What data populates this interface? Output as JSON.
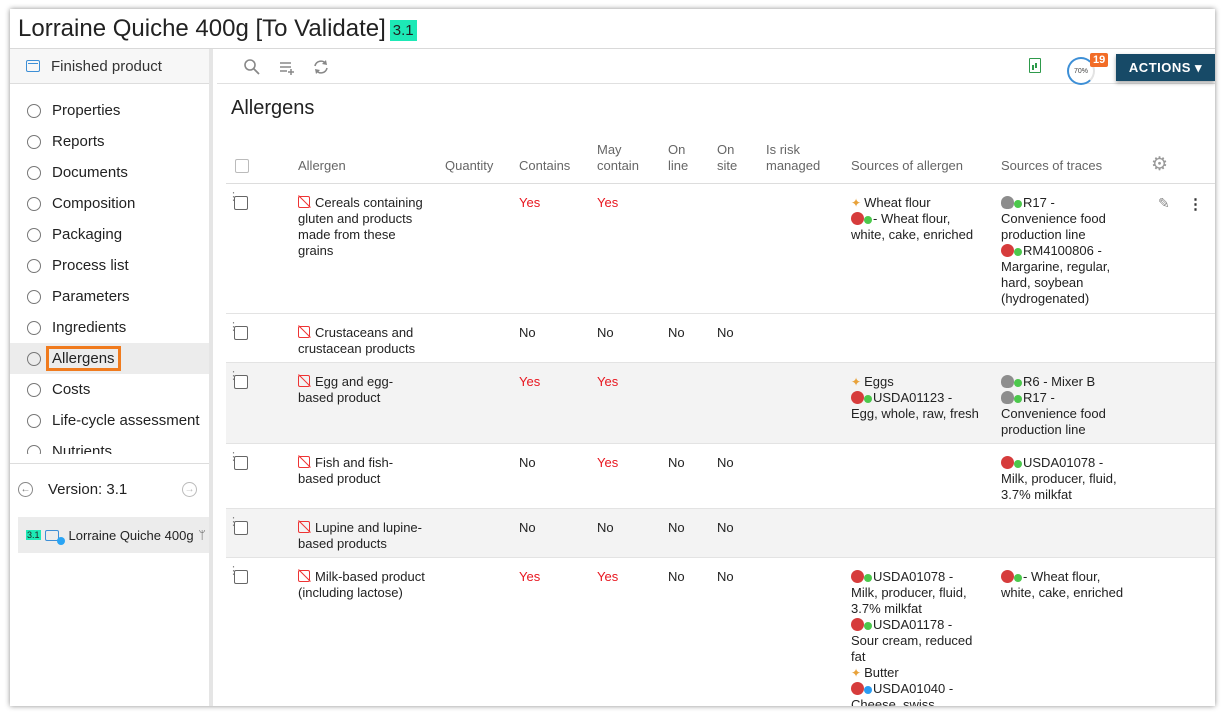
{
  "header": {
    "title": "Lorraine Quiche 400g [To Validate]",
    "version_badge": "3.1"
  },
  "sidebar": {
    "header_label": "Finished product",
    "items": [
      {
        "label": "Properties"
      },
      {
        "label": "Reports"
      },
      {
        "label": "Documents"
      },
      {
        "label": "Composition"
      },
      {
        "label": "Packaging"
      },
      {
        "label": "Process list"
      },
      {
        "label": "Parameters"
      },
      {
        "label": "Ingredients"
      },
      {
        "label": "Allergens"
      },
      {
        "label": "Costs"
      },
      {
        "label": "Life-cycle assessment"
      },
      {
        "label": "Nutrients"
      }
    ],
    "active_item": "Allergens",
    "version_label": "Version: 3.1",
    "node": {
      "badge": "3.1",
      "label": "Lorraine Quiche 400g"
    }
  },
  "toolbar": {
    "progress": "70%",
    "notification_count": "19",
    "actions_label": "ACTIONS ▾"
  },
  "section_title": "Allergens",
  "table": {
    "headers": {
      "allergen": "Allergen",
      "quantity": "Quantity",
      "contains": "Contains",
      "may_contain_1": "May",
      "may_contain_2": "contain",
      "on_line_1": "On",
      "on_line_2": "line",
      "on_site_1": "On",
      "on_site_2": "site",
      "risk_1": "Is risk",
      "risk_2": "managed",
      "sources_allergen": "Sources of allergen",
      "sources_traces": "Sources of traces"
    },
    "rows": [
      {
        "allergen": [
          "Cereals containing",
          "gluten and products",
          "made from these",
          "grains"
        ],
        "contains": "Yes",
        "may_contain": "Yes",
        "on_line": "",
        "on_site": "",
        "sources_allergen": [
          "Wheat flour",
          "- Wheat flour,",
          "white, cake, enriched"
        ],
        "sources_traces": [
          "R17 -",
          "Convenience food",
          "production line",
          "RM4100806 -",
          "Margarine, regular,",
          "hard, soybean",
          "(hydrogenated)"
        ]
      },
      {
        "allergen": [
          "Crustaceans and",
          "crustacean products"
        ],
        "contains": "No",
        "may_contain": "No",
        "on_line": "No",
        "on_site": "No",
        "sources_allergen": [],
        "sources_traces": []
      },
      {
        "allergen": [
          "Egg and egg-",
          "based product"
        ],
        "contains": "Yes",
        "may_contain": "Yes",
        "on_line": "",
        "on_site": "",
        "sources_allergen": [
          "Eggs",
          "USDA01123 -",
          "Egg, whole, raw, fresh"
        ],
        "sources_traces": [
          "R6 - Mixer B",
          "R17 -",
          "Convenience food",
          "production line"
        ]
      },
      {
        "allergen": [
          "Fish and fish-",
          "based product"
        ],
        "contains": "No",
        "may_contain": "Yes",
        "on_line": "No",
        "on_site": "No",
        "sources_allergen": [],
        "sources_traces": [
          "USDA01078 -",
          "Milk, producer, fluid,",
          "3.7% milkfat"
        ]
      },
      {
        "allergen": [
          "Lupine and lupine-",
          "based products"
        ],
        "contains": "No",
        "may_contain": "No",
        "on_line": "No",
        "on_site": "No",
        "sources_allergen": [],
        "sources_traces": []
      },
      {
        "allergen": [
          "Milk-based product",
          "(including lactose)"
        ],
        "contains": "Yes",
        "may_contain": "Yes",
        "on_line": "No",
        "on_site": "No",
        "sources_allergen": [
          "USDA01078 -",
          "Milk, producer, fluid,",
          "3.7% milkfat",
          "USDA01178 -",
          "Sour cream, reduced",
          "fat",
          "Butter",
          "USDA01040 -",
          "Cheese, swiss"
        ],
        "sources_traces": [
          "- Wheat flour,",
          "white, cake, enriched"
        ]
      }
    ]
  },
  "colors": {
    "accent": "#174a67",
    "active_outline": "#f07b1e",
    "yes_red": "#e8161f",
    "version_badge": "#1de9b6",
    "badge_orange": "#f26c26"
  },
  "icons": [
    "finished-product-icon",
    "search-icon",
    "add-list-icon",
    "refresh-icon",
    "report-icon",
    "settings-gear-icon",
    "allergen-icon",
    "edit-pencil-icon",
    "more-vertical-icon",
    "back-icon",
    "forward-icon",
    "branch-icon",
    "wheat-icon",
    "raw-material-icon",
    "resource-icon"
  ]
}
